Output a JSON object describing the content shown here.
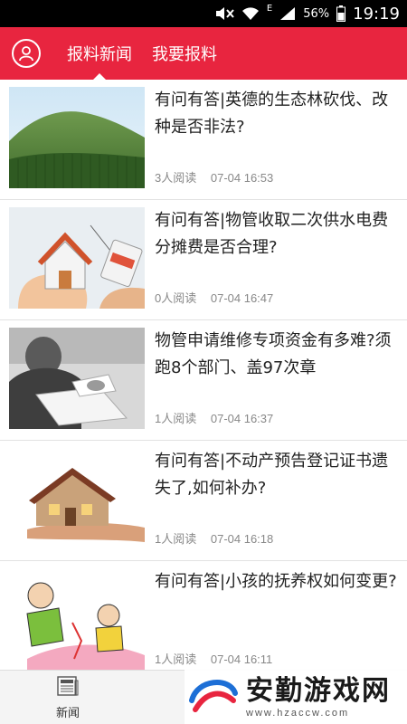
{
  "status_bar": {
    "battery": "56%",
    "time": "19:19",
    "network": "E",
    "icons": [
      "mute-icon",
      "wifi-icon",
      "signal-icon",
      "battery-icon"
    ]
  },
  "header": {
    "avatar_icon": "user-icon",
    "tabs": [
      {
        "label": "报料新闻",
        "active": true
      },
      {
        "label": "我要报料",
        "active": false
      }
    ],
    "background": "#e8253f"
  },
  "news": [
    {
      "title": "有问有答|英德的生态林砍伐、改种是否非法?",
      "reads": "3人阅读",
      "time": "07-04 16:53",
      "thumb": "forest-hill"
    },
    {
      "title": "有问有答|物管收取二次供水电费分摊费是否合理?",
      "reads": "0人阅读",
      "time": "07-04 16:47",
      "thumb": "house-in-hands"
    },
    {
      "title": "物管申请维修专项资金有多难?须跑8个部门、盖97次章",
      "reads": "1人阅读",
      "time": "07-04 16:37",
      "thumb": "stamping-documents"
    },
    {
      "title": "有问有答|不动产预告登记证书遗失了,如何补办?",
      "reads": "1人阅读",
      "time": "07-04 16:18",
      "thumb": "house-model-hand"
    },
    {
      "title": "有问有答|小孩的抚养权如何变更?",
      "reads": "1人阅读",
      "time": "07-04 16:11",
      "thumb": "cartoon-family"
    }
  ],
  "bottom_nav": {
    "news_label": "新闻",
    "news_icon": "newspaper-icon",
    "news_icon_text": "NEWS"
  },
  "watermark": {
    "text": "安勤游戏网",
    "url": "www.hzaccw.com"
  }
}
